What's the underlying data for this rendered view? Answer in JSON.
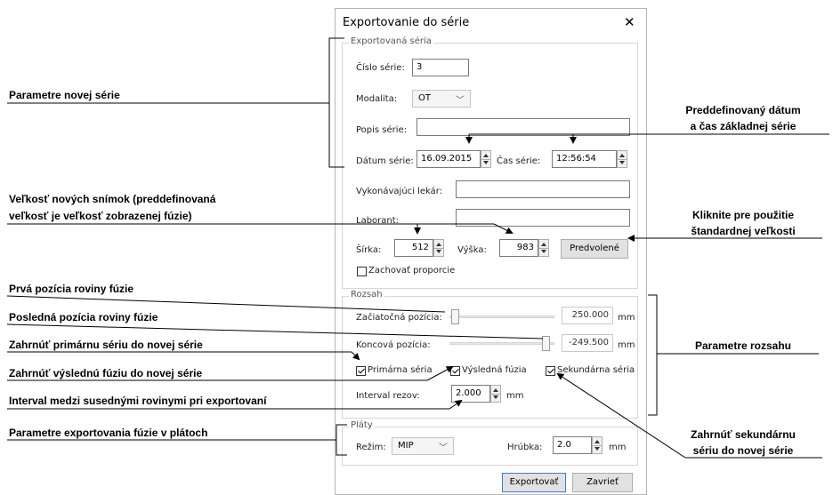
{
  "dialog": {
    "title": "Exportovanie do série",
    "close_symbol": "✕",
    "series_group": {
      "label": "Exportovaná séria",
      "series_number_label": "Číslo série:",
      "series_number_value": "3",
      "modality_label": "Modalita:",
      "modality_value": "OT",
      "description_label": "Popis série:",
      "description_value": "",
      "date_label": "Dátum série:",
      "date_value": "16.09.2015",
      "time_label": "Čas série:",
      "time_value": "12:56:54",
      "physician_label": "Vykonávajúci lekár:",
      "physician_value": "",
      "operator_label": "Laborant:",
      "operator_value": "",
      "width_label": "Šírka:",
      "width_value": "512",
      "height_label": "Výška:",
      "height_value": "983",
      "default_button": "Predvolené",
      "keep_ratio_label": "Zachovať proporcie",
      "keep_ratio_checked": false
    },
    "range_group": {
      "label": "Rozsah",
      "start_label": "Začiatočná pozícia:",
      "start_value": "250.000",
      "start_unit": "mm",
      "end_label": "Koncová pozícia:",
      "end_value": "-249.500",
      "end_unit": "mm",
      "primary_label": "Primárna séria",
      "primary_checked": true,
      "result_label": "Výsledná fúzia",
      "result_checked": true,
      "secondary_label": "Sekundárna séria",
      "secondary_checked": true,
      "interval_label": "Interval rezov:",
      "interval_value": "2.000",
      "interval_unit": "mm"
    },
    "slabs_group": {
      "label": "Pláty",
      "mode_label": "Režim:",
      "mode_value": "MIP",
      "thickness_label": "Hrúbka:",
      "thickness_value": "2.0",
      "thickness_unit": "mm"
    },
    "export_button": "Exportovať",
    "close_button": "Zavrieť"
  },
  "annotations": {
    "new_series_params": "Parametre novej série",
    "predefined_date_1": "Preddefinovaný dátum",
    "predefined_date_2": "a čas základnej série",
    "image_size_1": "Veľkosť nových snímok (preddefinovaná",
    "image_size_2": "veľkosť je veľkosť zobrazenej fúzie)",
    "default_size_1": "Kliknite pre použitie",
    "default_size_2": "štandardnej veľkosti",
    "first_plane": "Prvá pozícia roviny fúzie",
    "last_plane": "Posledná pozícia roviny fúzie",
    "include_primary": "Zahrnúť primárnu sériu do novej série",
    "include_result": "Zahrnúť výslednú fúziu do novej série",
    "interval_desc": "Interval medzi susednými rovinymi pri exportovaní",
    "slab_params": "Parametre exportovania fúzie v plátoch",
    "range_params": "Parametre rozsahu",
    "include_secondary_1": "Zahrnúť sekundárnu",
    "include_secondary_2": "sériu do novej série"
  }
}
